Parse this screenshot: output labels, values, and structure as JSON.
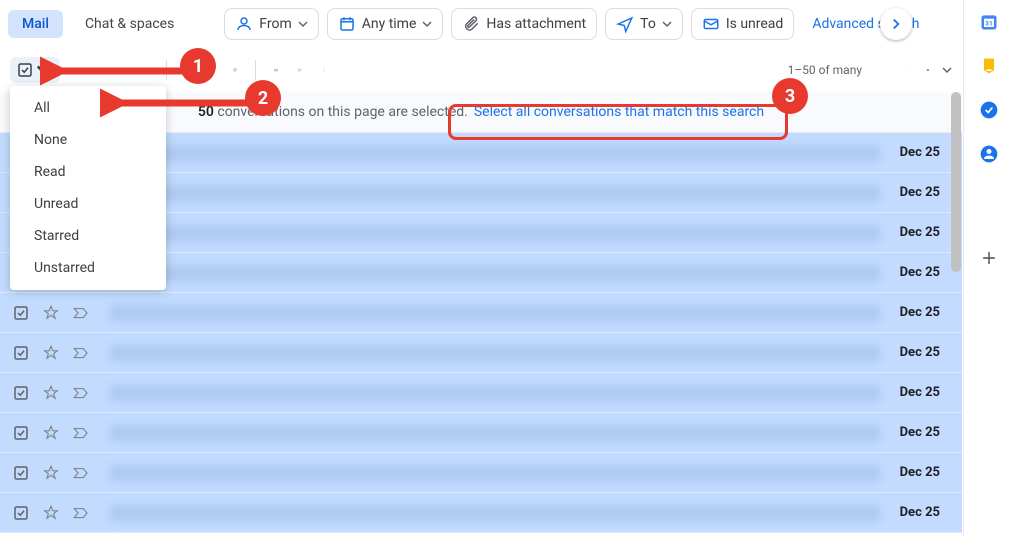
{
  "tabs": {
    "mail": "Mail",
    "chat": "Chat & spaces"
  },
  "filters": {
    "from": "From",
    "anytime": "Any time",
    "attachment": "Has attachment",
    "to": "To",
    "unread": "Is unread",
    "advanced": "Advanced search"
  },
  "pagination": "1–50 of many",
  "dropdown": {
    "items": [
      "All",
      "None",
      "Read",
      "Unread",
      "Starred",
      "Unstarred"
    ]
  },
  "banner": {
    "count": "50",
    "text": " conversations on this page are selected. ",
    "link": "Select all conversations that match this search"
  },
  "emails": {
    "dates": [
      "Dec 25",
      "Dec 25",
      "Dec 25",
      "Dec 25",
      "Dec 25",
      "Dec 25",
      "Dec 25",
      "Dec 25",
      "Dec 25",
      "Dec 25"
    ]
  },
  "annotations": {
    "n1": "1",
    "n2": "2",
    "n3": "3"
  }
}
